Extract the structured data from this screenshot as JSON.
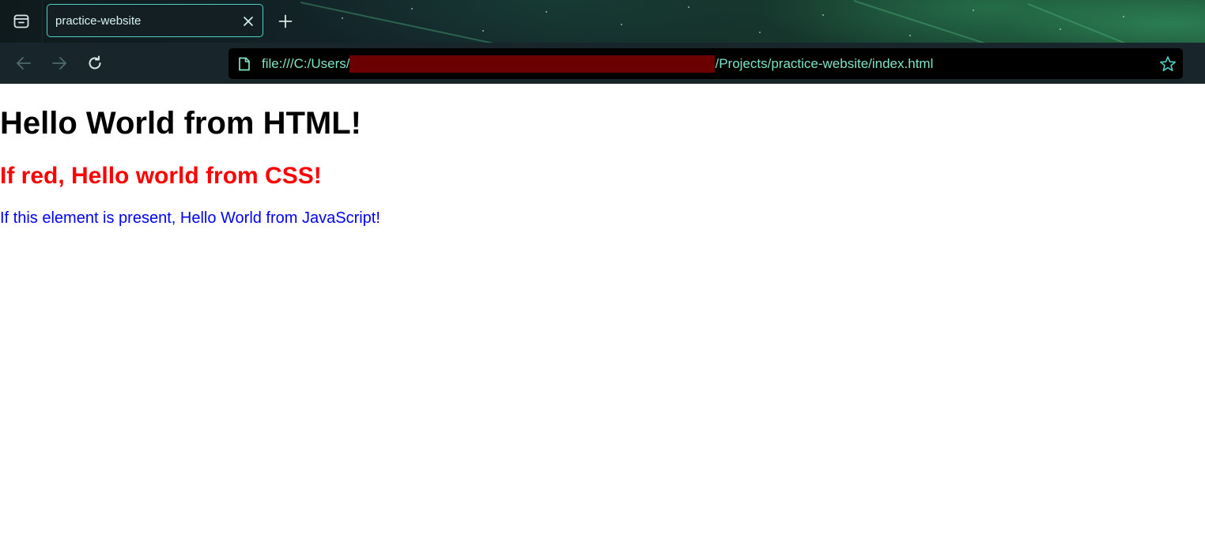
{
  "browser": {
    "tab": {
      "title": "practice-website",
      "close_icon": "close-icon"
    },
    "new_tab_icon": "plus-icon",
    "side_panel_icon": "sidebar-panel-icon",
    "nav": {
      "back_icon": "arrow-left-icon",
      "forward_icon": "arrow-right-icon",
      "reload_icon": "reload-icon"
    },
    "url": {
      "prefix": "file:///C:/Users/",
      "suffix": "/Projects/practice-website/index.html",
      "redacted": true,
      "file_icon": "file-icon",
      "bookmark_icon": "star-icon"
    },
    "colors": {
      "accent": "#4fd1c5",
      "url_text": "#7fe3c7",
      "redaction": "#6b0000"
    }
  },
  "page": {
    "heading": "Hello World from HTML!",
    "css_heading": "If red, Hello world from CSS!",
    "js_paragraph": "If this element is present, Hello World from JavaScript!",
    "colors": {
      "heading": "#000000",
      "css_heading": "#ff0000",
      "js_paragraph": "#0000ff"
    }
  }
}
